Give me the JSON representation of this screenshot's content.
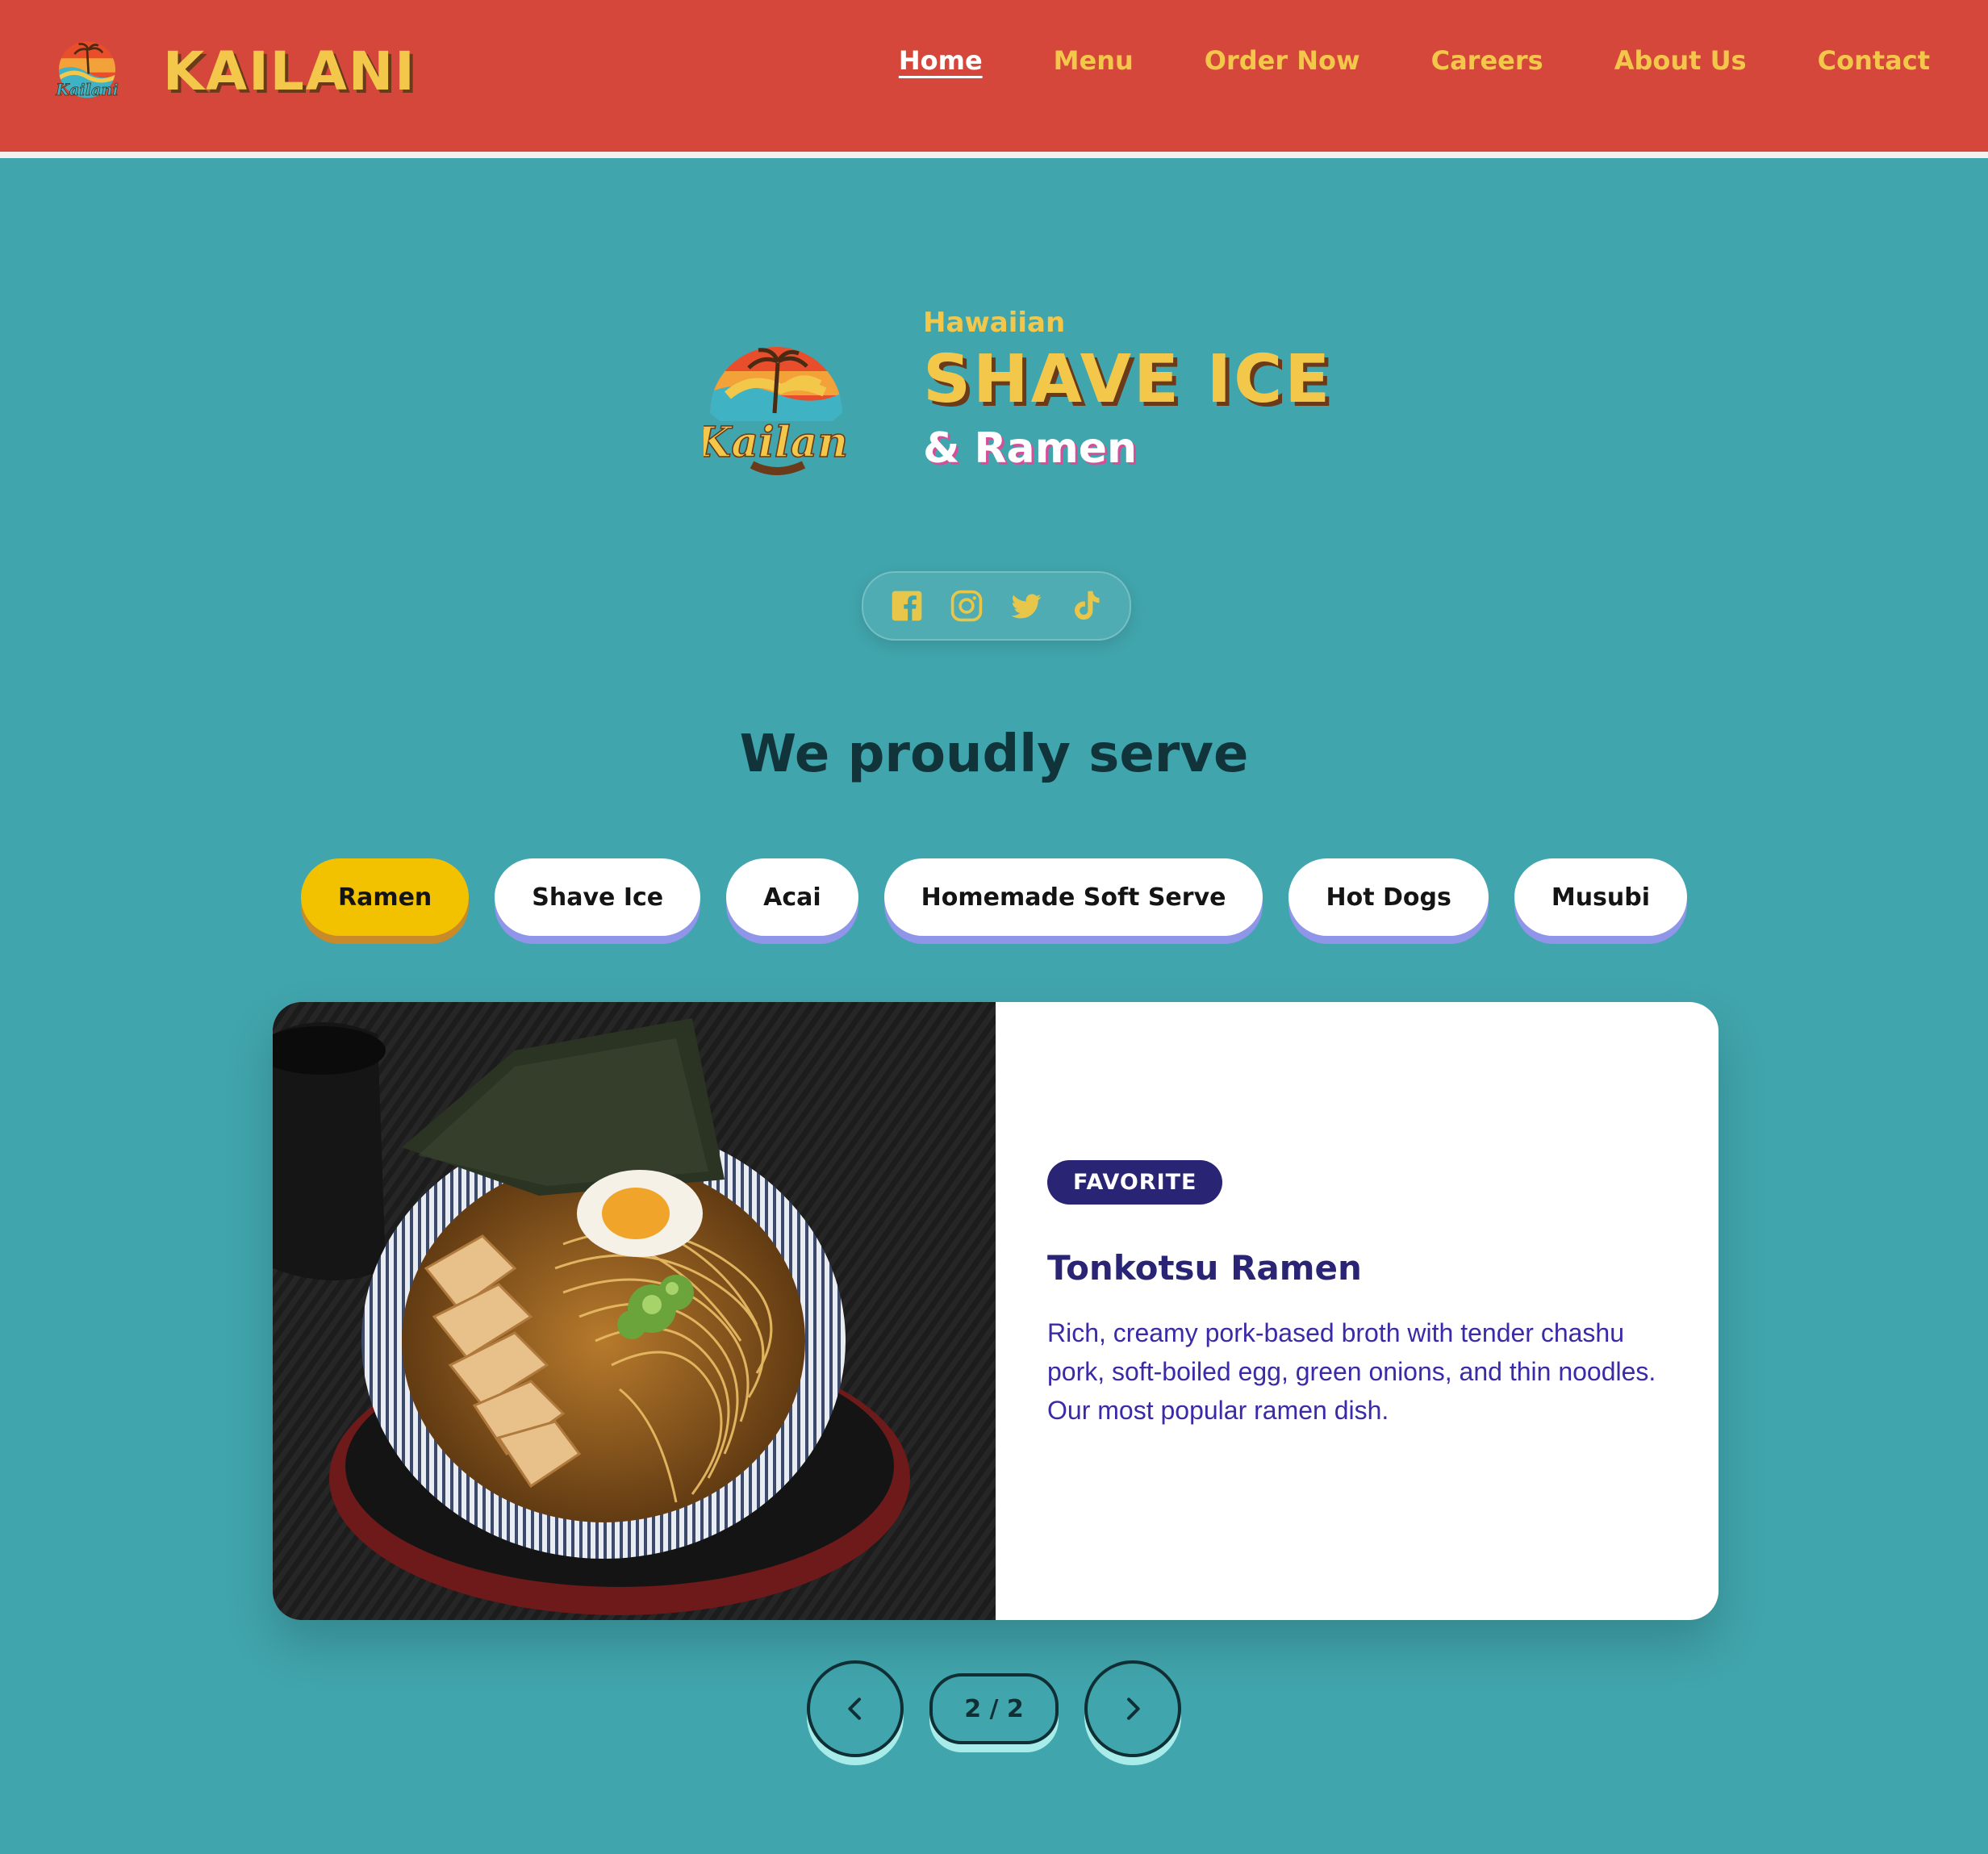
{
  "header": {
    "brand_name": "KAILANI",
    "logo_text": "Kailani",
    "nav": [
      {
        "label": "Home",
        "active": true
      },
      {
        "label": "Menu"
      },
      {
        "label": "Order Now"
      },
      {
        "label": "Careers"
      },
      {
        "label": "About Us"
      },
      {
        "label": "Contact"
      }
    ]
  },
  "hero": {
    "logo_text": "Kailani",
    "subtitle": "Hawaiian",
    "title": "SHAVE ICE",
    "tagline": "& Ramen"
  },
  "socials": [
    "facebook-icon",
    "instagram-icon",
    "twitter-icon",
    "tiktok-icon"
  ],
  "section": {
    "title": "We proudly serve"
  },
  "categories": [
    {
      "label": "Ramen",
      "active": true
    },
    {
      "label": "Shave Ice"
    },
    {
      "label": "Acai"
    },
    {
      "label": "Homemade Soft Serve"
    },
    {
      "label": "Hot Dogs"
    },
    {
      "label": "Musubi"
    }
  ],
  "featured": {
    "badge": "FAVORITE",
    "title": "Tonkotsu Ramen",
    "description": "Rich, creamy pork-based broth with tender chashu pork, soft-boiled egg, green onions, and thin noodles. Our most popular ramen dish."
  },
  "pager": {
    "label": "2 / 2",
    "prev_icon": "chevron-left-icon",
    "next_icon": "chevron-right-icon"
  },
  "colors": {
    "header_bg": "#d6473b",
    "page_bg": "#41a5ad",
    "accent_yellow": "#f3c84a",
    "active_pill": "#f2c100",
    "badge_bg": "#2a2475",
    "text_purple": "#3a2aa8"
  }
}
